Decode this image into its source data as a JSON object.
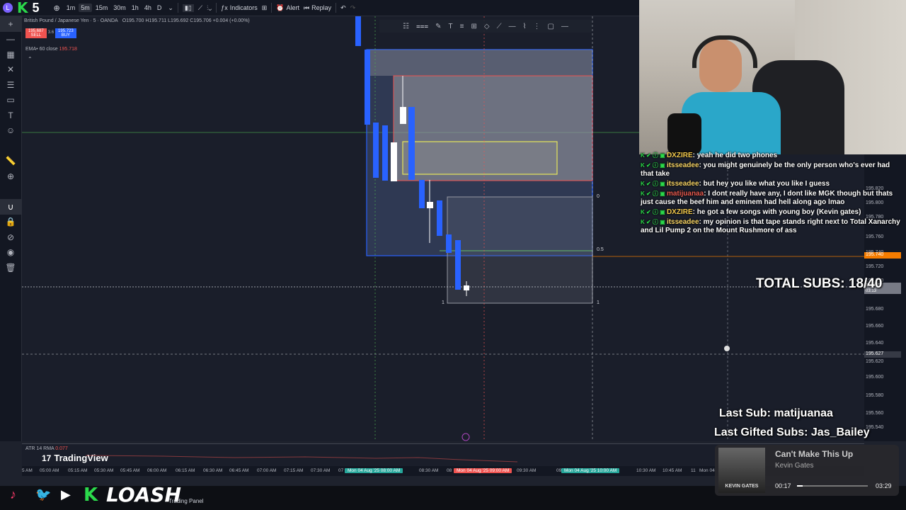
{
  "topbar": {
    "logo_letter": "L",
    "stream_badge": "K",
    "stream_num": "5",
    "timeframes": [
      "1m",
      "5m",
      "15m",
      "30m",
      "1h",
      "4h",
      "D"
    ],
    "active_timeframe": "5m",
    "indicators_label": "Indicators",
    "alert_label": "Alert",
    "replay_label": "Replay"
  },
  "chart": {
    "symbol_text": "British Pound / Japanese Yen · 5 · OANDA",
    "ohlc_text": "O195.700 H195.711 L195.692 C195.706 +0.004 (+0.00%)",
    "sell_price": "195.687",
    "sell_label": "SELL",
    "spread": "3.6",
    "buy_price": "195.723",
    "buy_label": "BUY",
    "ema_label": "EMA• 60 close",
    "ema_value": "195.718",
    "fib_top_label": "0",
    "fib_mid_label": "0.5",
    "fib_bottom_label": "1",
    "fib_bottom_label2": "1",
    "atr_label": "ATR 14 RMA",
    "atr_value": "0.077",
    "tradingview_label": "TradingView"
  },
  "price_axis": {
    "labels": [
      "195.820",
      "195.800",
      "195.780",
      "195.760",
      "195.740",
      "195.720",
      "195.700",
      "195.680",
      "195.660",
      "195.640",
      "195.627",
      "195.620",
      "195.600",
      "195.580",
      "195.560",
      "195.540"
    ],
    "highlight_price": "195.740",
    "current_price": "195.703",
    "current_sub": "03:13",
    "crosshair_price": "195.627"
  },
  "time_axis": {
    "labels": [
      "5 AM",
      "05:00 AM",
      "05:15 AM",
      "05:30 AM",
      "05:45 AM",
      "06:00 AM",
      "06:15 AM",
      "06:30 AM",
      "06:45 AM",
      "07:00 AM",
      "07:15 AM",
      "07:30 AM",
      "07",
      "08:30 AM",
      "08",
      "09:30 AM",
      "09",
      "10:30 AM",
      "10:45 AM",
      "11",
      "Mon 04"
    ],
    "badge_1": "Mon 04 Aug '25 08:00 AM",
    "badge_2": "Mon 04 Aug '25 09:00 AM",
    "badge_3": "Mon 04 Aug '25 10:00 AM"
  },
  "chat": [
    {
      "user": "DXZIRE",
      "text": ": yeah he did two phones",
      "color": "#f2c94c"
    },
    {
      "user": "itsseadee",
      "text": ": you might genuinely be the only person who's ever had that take",
      "color": "#f6d365"
    },
    {
      "user": "itsseadee",
      "text": ": but hey you like what you like I guess",
      "color": "#f6d365"
    },
    {
      "user": "matijuanaa",
      "text": ": I dont really have any, I dont like MGK though but thats just cause the beef him and eminem had hell along ago lmao",
      "color": "#e85a4f"
    },
    {
      "user": "DXZIRE",
      "text": ": he got a few songs with young boy (Kevin gates)",
      "color": "#f2c94c"
    },
    {
      "user": "itsseadee",
      "text": ": my opinion is that tape stands right next to Total Xanarchy and Lil Pump 2 on the Mount Rushmore of ass",
      "color": "#f6d365"
    }
  ],
  "overlays": {
    "total_subs": "TOTAL SUBS: 18/40",
    "last_sub": "Last Sub: matijuanaa",
    "last_gifted": "Last Gifted Subs: Jas_Bailey"
  },
  "now_playing": {
    "title": "Can't Make This Up",
    "artist": "Kevin Gates",
    "cover_text": "KEVIN GATES",
    "elapsed": "00:17",
    "duration": "03:29",
    "progress": 0.08
  },
  "bottom": {
    "brand": "LOASH",
    "trading_panel": "Trading Panel"
  },
  "colors": {
    "bull": "#ffffff",
    "bear": "#2962ff",
    "accent_green": "#2bd94b"
  }
}
